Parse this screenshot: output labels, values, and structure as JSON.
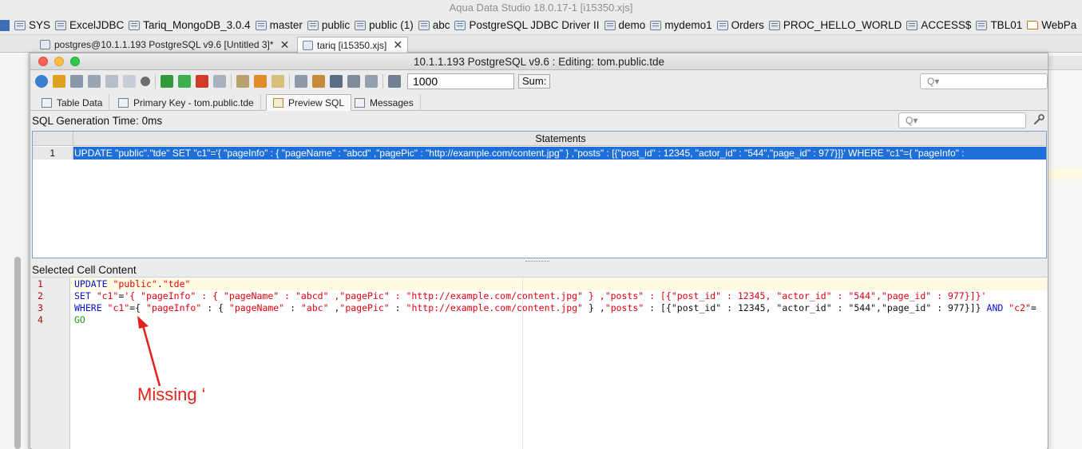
{
  "app": {
    "title": "Aqua Data Studio 18.0.17-1 [i15350.xjs]"
  },
  "favorites": [
    {
      "label": "SYS",
      "icon": "db-icon"
    },
    {
      "label": "ExcelJDBC",
      "icon": "db-icon"
    },
    {
      "label": "Tariq_MongoDB_3.0.4",
      "icon": "db-icon"
    },
    {
      "label": "master",
      "icon": "db-icon"
    },
    {
      "label": "public",
      "icon": "db-icon"
    },
    {
      "label": "public (1)",
      "icon": "db-icon"
    },
    {
      "label": "abc",
      "icon": "db-icon"
    },
    {
      "label": "PostgreSQL JDBC Driver II",
      "icon": "db-icon"
    },
    {
      "label": "demo",
      "icon": "db-icon"
    },
    {
      "label": "mydemo1",
      "icon": "db-icon"
    },
    {
      "label": "Orders",
      "icon": "db-icon"
    },
    {
      "label": "PROC_HELLO_WORLD",
      "icon": "db-icon"
    },
    {
      "label": "ACCESS$",
      "icon": "db-icon"
    },
    {
      "label": "TBL01",
      "icon": "db-icon"
    },
    {
      "label": "WebPa",
      "icon": "folder-icon"
    }
  ],
  "doc_tabs": [
    {
      "label": "postgres@10.1.1.193 PostgreSQL  v9.6 [Untitled 3]*",
      "active": false
    },
    {
      "label": "tariq [i15350.xjs]",
      "active": true
    }
  ],
  "window": {
    "title": "10.1.1.193 PostgreSQL  v9.6 : Editing: tom.public.tde",
    "result_limit": "1000",
    "sum_label": "Sum:",
    "search_placeholder": "Q▾"
  },
  "sub_tabs": [
    {
      "label": "Table Data",
      "active": false
    },
    {
      "label": "Primary Key - tom.public.tde",
      "active": false
    },
    {
      "label": "Preview SQL",
      "active": true
    },
    {
      "label": "Messages",
      "active": false
    }
  ],
  "preview": {
    "generation_time": "SQL Generation Time: 0ms",
    "column_header": "Statements",
    "rows": [
      {
        "num": "1",
        "statement": "UPDATE \"public\".\"tde\" SET \"c1\"='{ \"pageInfo\" : { \"pageName\" : \"abcd\" ,\"pagePic\" : \"http://example.com/content.jpg\" } ,\"posts\" : [{\"post_id\" : 12345, \"actor_id\" : \"544\",\"page_id\" : 977}]}' WHERE \"c1\"={ \"pageInfo\" :"
      }
    ]
  },
  "cell_content": {
    "label": "Selected Cell Content",
    "line_numbers": [
      "1",
      "2",
      "3",
      "4"
    ],
    "lines": [
      [
        {
          "t": "UPDATE ",
          "c": "kw"
        },
        {
          "t": "\"public\"",
          "c": "str"
        },
        {
          "t": ".",
          "c": "plain"
        },
        {
          "t": "\"tde\"",
          "c": "str"
        }
      ],
      [
        {
          "t": "SET ",
          "c": "kw"
        },
        {
          "t": "\"c1\"",
          "c": "str"
        },
        {
          "t": "=",
          "c": "plain"
        },
        {
          "t": "'{ \"pageInfo\" : { \"pageName\" : \"abcd\" ,\"pagePic\" : \"http://example.com/content.jpg\" } ,\"posts\" : [{\"post_id\" : 12345, \"actor_id\" : \"544\",\"page_id\" : 977}]}'",
          "c": "str"
        }
      ],
      [
        {
          "t": "WHERE ",
          "c": "kw"
        },
        {
          "t": "\"c1\"",
          "c": "str"
        },
        {
          "t": "={ ",
          "c": "plain"
        },
        {
          "t": "\"pageInfo\"",
          "c": "str"
        },
        {
          "t": " : { ",
          "c": "plain"
        },
        {
          "t": "\"pageName\"",
          "c": "str"
        },
        {
          "t": " : ",
          "c": "plain"
        },
        {
          "t": "\"abc\"",
          "c": "str"
        },
        {
          "t": " ,",
          "c": "plain"
        },
        {
          "t": "\"pagePic\"",
          "c": "str"
        },
        {
          "t": " : ",
          "c": "plain"
        },
        {
          "t": "\"http://example.com/content.jpg\"",
          "c": "str"
        },
        {
          "t": " } ,",
          "c": "plain"
        },
        {
          "t": "\"posts\"",
          "c": "str"
        },
        {
          "t": " : [{\"post_id\" : 12345, \"actor_id\" : \"544\",\"page_id\" : 977}]} ",
          "c": "plain"
        },
        {
          "t": "AND ",
          "c": "kw"
        },
        {
          "t": "\"c2\"",
          "c": "str"
        },
        {
          "t": "=",
          "c": "plain"
        }
      ],
      [
        {
          "t": "GO",
          "c": "go"
        }
      ]
    ]
  },
  "annotation": {
    "text": "Missing ‘",
    "color": "#e2231a"
  }
}
